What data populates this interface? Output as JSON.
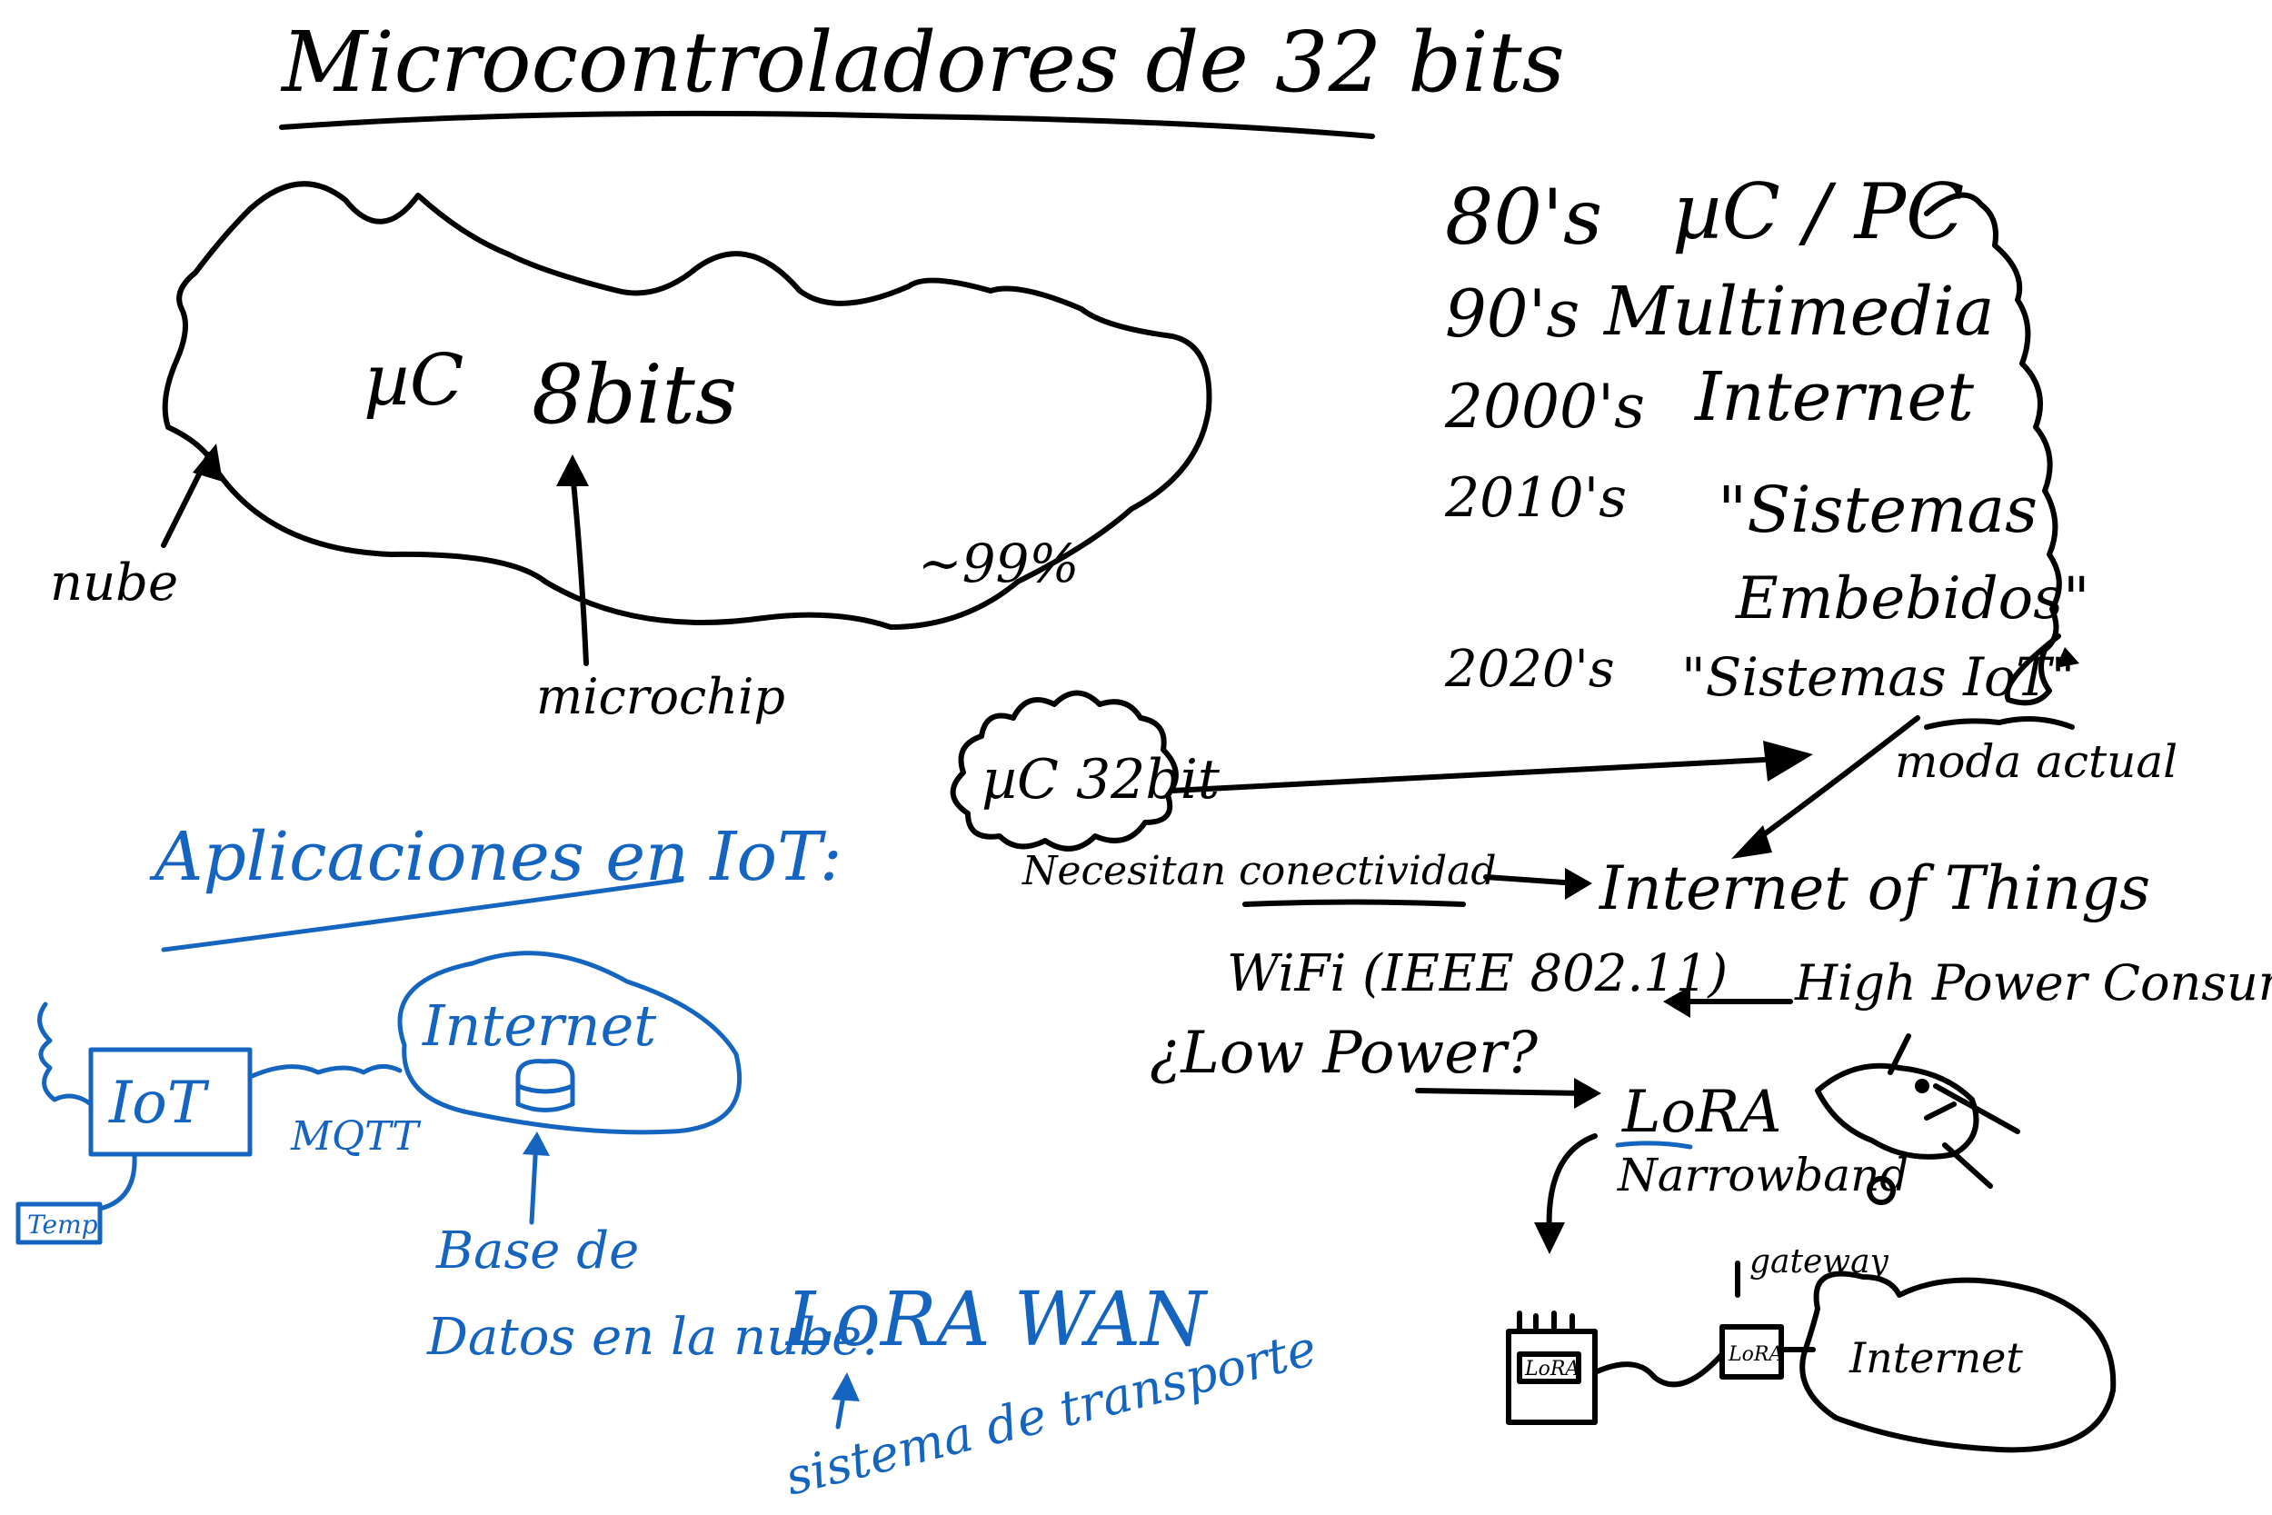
{
  "title": "Microcontroladores de 32 bits",
  "cloud_8bit": {
    "label_uc": "µC",
    "label_8bits": "8bits",
    "percent": "~99%",
    "nube": "nube",
    "microchip": "microchip"
  },
  "timeline": [
    {
      "decade": "80's",
      "text": "µC / PC"
    },
    {
      "decade": "90's",
      "text": "Multimedia"
    },
    {
      "decade": "2000's",
      "text": "Internet"
    },
    {
      "decade": "2010's",
      "text": "\"Sistemas"
    },
    {
      "decade": "",
      "text": "Embebidos\""
    },
    {
      "decade": "2020's",
      "text": "\"Sistemas IoT\""
    }
  ],
  "moda_actual": "moda actual",
  "cloud_32bit": "µC 32bit",
  "necesitan": "Necesitan conectividad",
  "iot_main": "Internet of Things",
  "wifi": "WiFi (IEEE 802.11)",
  "high_power": "High Power Consumption",
  "low_power": "¿Low Power?",
  "lora": "LoRA",
  "narrowband": "Narrowband",
  "gateway": "gateway",
  "internet_right": "Internet",
  "lora_box": "LoRA",
  "gw_box": "LoRA",
  "apps": {
    "heading": "Aplicaciones en IoT:",
    "iot": "IoT",
    "internet": "Internet",
    "mqtt": "MQTT",
    "temp": "Temp",
    "base1": "Base de",
    "base2": "Datos en la nube.",
    "lorawan": "LoRA WAN",
    "sistema": "sistema de transporte"
  }
}
